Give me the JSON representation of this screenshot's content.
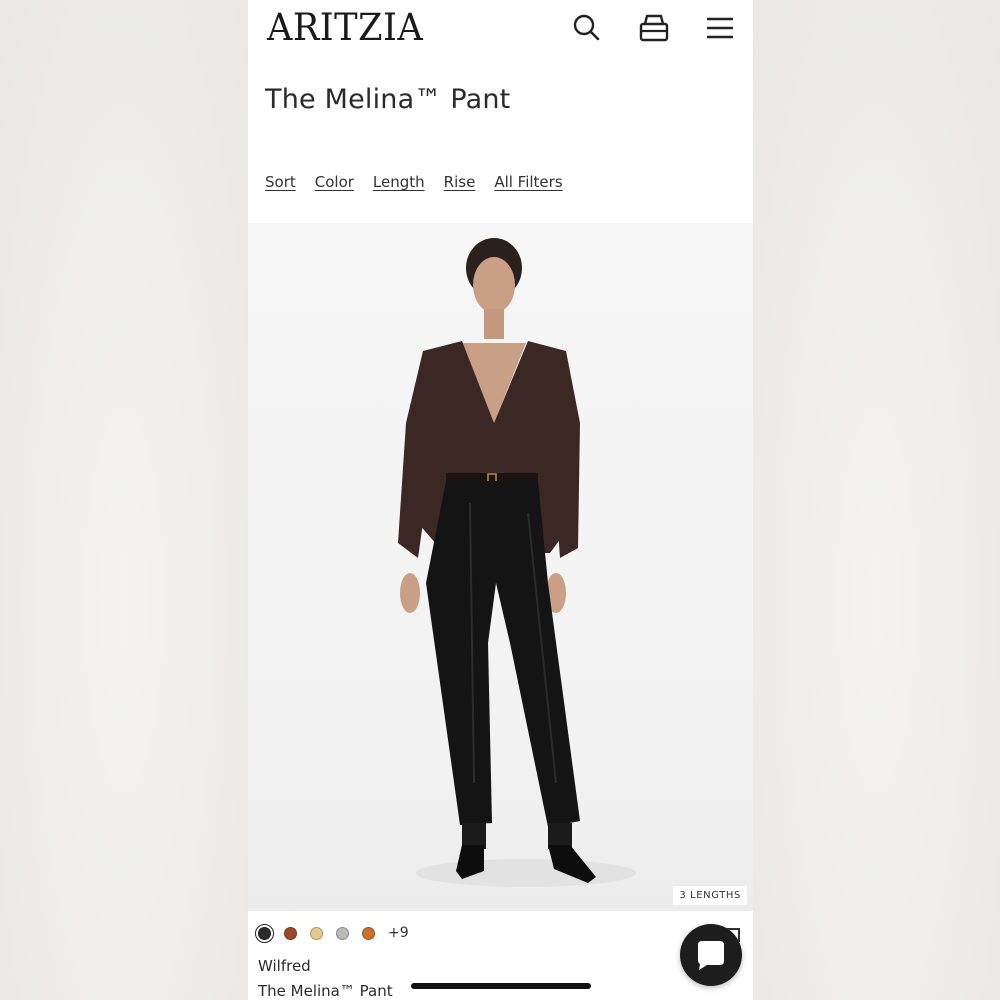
{
  "header": {
    "logo": "ARITZIA",
    "icons": [
      "search-icon",
      "bag-icon",
      "menu-icon"
    ]
  },
  "page": {
    "title": "The Melina™ Pant"
  },
  "filters": [
    "Sort",
    "Color",
    "Length",
    "Rise",
    "All Filters"
  ],
  "product": {
    "badge": "3 LENGTHS",
    "swatches": [
      "#2b2b2b",
      "#9a4a2a",
      "#e3c98a",
      "#bdbab5",
      "#c9722e"
    ],
    "more_colors": "+9",
    "brand": "Wilfred",
    "name": "The Melina™ Pant"
  },
  "colors": {
    "sweater": "#3b2825",
    "pants": "#141414",
    "chat": "#1d1d1d"
  }
}
